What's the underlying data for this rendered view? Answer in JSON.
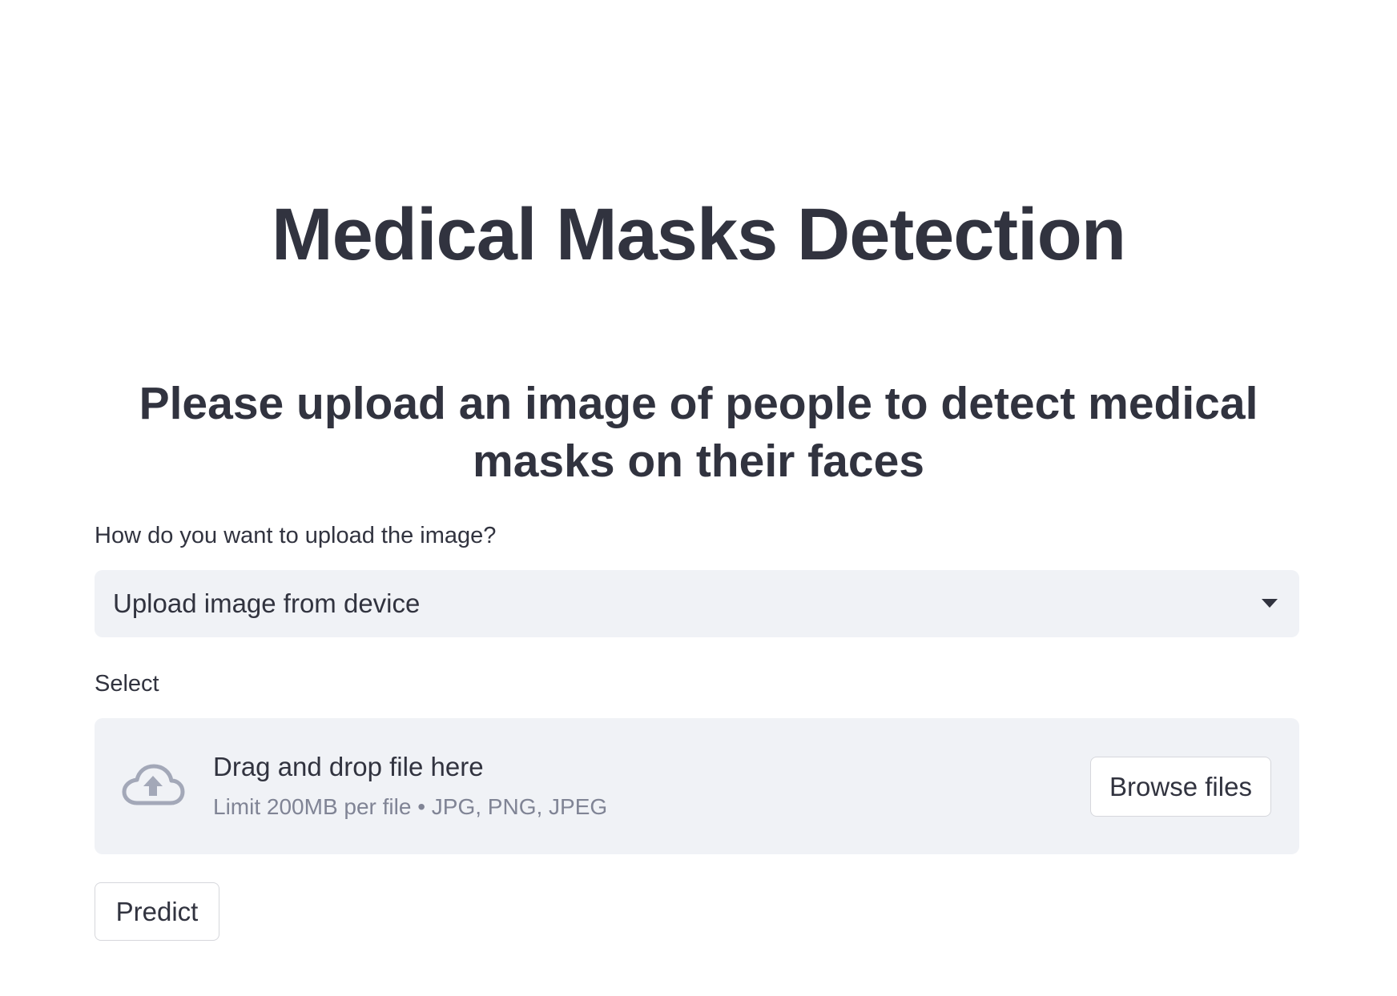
{
  "header": {
    "title": "Medical Masks Detection",
    "subtitle": "Please upload an image of people to detect medical masks on their faces"
  },
  "upload_method": {
    "label": "How do you want to upload the image?",
    "selected": "Upload image from device"
  },
  "uploader": {
    "label": "Select",
    "drop_text": "Drag and drop file here",
    "limit_text": "Limit 200MB per file • JPG, PNG, JPEG",
    "browse_label": "Browse files",
    "icon": "cloud-upload-icon"
  },
  "actions": {
    "predict_label": "Predict"
  },
  "colors": {
    "text": "#31333f",
    "muted_text": "#808495",
    "field_bg": "#f0f2f6",
    "icon": "#a3a8b8"
  }
}
